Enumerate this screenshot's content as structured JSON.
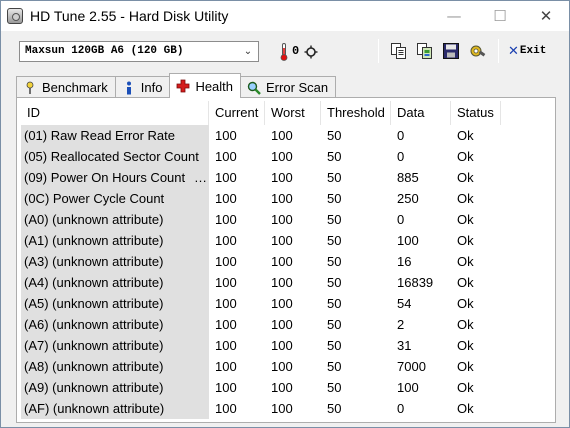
{
  "window": {
    "title": "HD Tune 2.55 - Hard Disk Utility",
    "controls": {
      "minimize": "—",
      "maximize": "☐",
      "close": "✕"
    }
  },
  "toolbar": {
    "drive": "Maxsun  120GB A6 (120 GB)",
    "temperature": "0",
    "exit_label": "Exit",
    "icons": [
      "thermometer-icon",
      "temperature-unit-icon",
      "copy-text-icon",
      "copy-screenshot-icon",
      "save-icon",
      "options-icon",
      "exit-icon"
    ]
  },
  "tabs": [
    {
      "label": "Benchmark",
      "icon": "benchmark-icon",
      "active": false
    },
    {
      "label": "Info",
      "icon": "info-icon",
      "active": false
    },
    {
      "label": "Health",
      "icon": "health-icon",
      "active": true
    },
    {
      "label": "Error Scan",
      "icon": "error-scan-icon",
      "active": false
    }
  ],
  "health": {
    "columns": [
      "ID",
      "Current",
      "Worst",
      "Threshold",
      "Data",
      "Status"
    ],
    "rows": [
      [
        "(01) Raw Read Error Rate",
        "100",
        "100",
        "50",
        "0",
        "Ok"
      ],
      [
        "(05) Reallocated Sector Count",
        "100",
        "100",
        "50",
        "0",
        "Ok"
      ],
      [
        "(09) Power On Hours Count",
        "100",
        "100",
        "50",
        "885",
        "Ok"
      ],
      [
        "(0C) Power Cycle Count",
        "100",
        "100",
        "50",
        "250",
        "Ok"
      ],
      [
        "(A0) (unknown attribute)",
        "100",
        "100",
        "50",
        "0",
        "Ok"
      ],
      [
        "(A1) (unknown attribute)",
        "100",
        "100",
        "50",
        "100",
        "Ok"
      ],
      [
        "(A3) (unknown attribute)",
        "100",
        "100",
        "50",
        "16",
        "Ok"
      ],
      [
        "(A4) (unknown attribute)",
        "100",
        "100",
        "50",
        "16839",
        "Ok"
      ],
      [
        "(A5) (unknown attribute)",
        "100",
        "100",
        "50",
        "54",
        "Ok"
      ],
      [
        "(A6) (unknown attribute)",
        "100",
        "100",
        "50",
        "2",
        "Ok"
      ],
      [
        "(A7) (unknown attribute)",
        "100",
        "100",
        "50",
        "31",
        "Ok"
      ],
      [
        "(A8) (unknown attribute)",
        "100",
        "100",
        "50",
        "7000",
        "Ok"
      ],
      [
        "(A9) (unknown attribute)",
        "100",
        "100",
        "50",
        "100",
        "Ok"
      ],
      [
        "(AF) (unknown attribute)",
        "100",
        "100",
        "50",
        "0",
        "Ok"
      ]
    ]
  },
  "colors": {
    "id_column_bg": "#e0e0e0",
    "window_bg": "#f0f0f0",
    "exit_x": "#1a3fb0",
    "health_cross": "#d41c1c"
  }
}
